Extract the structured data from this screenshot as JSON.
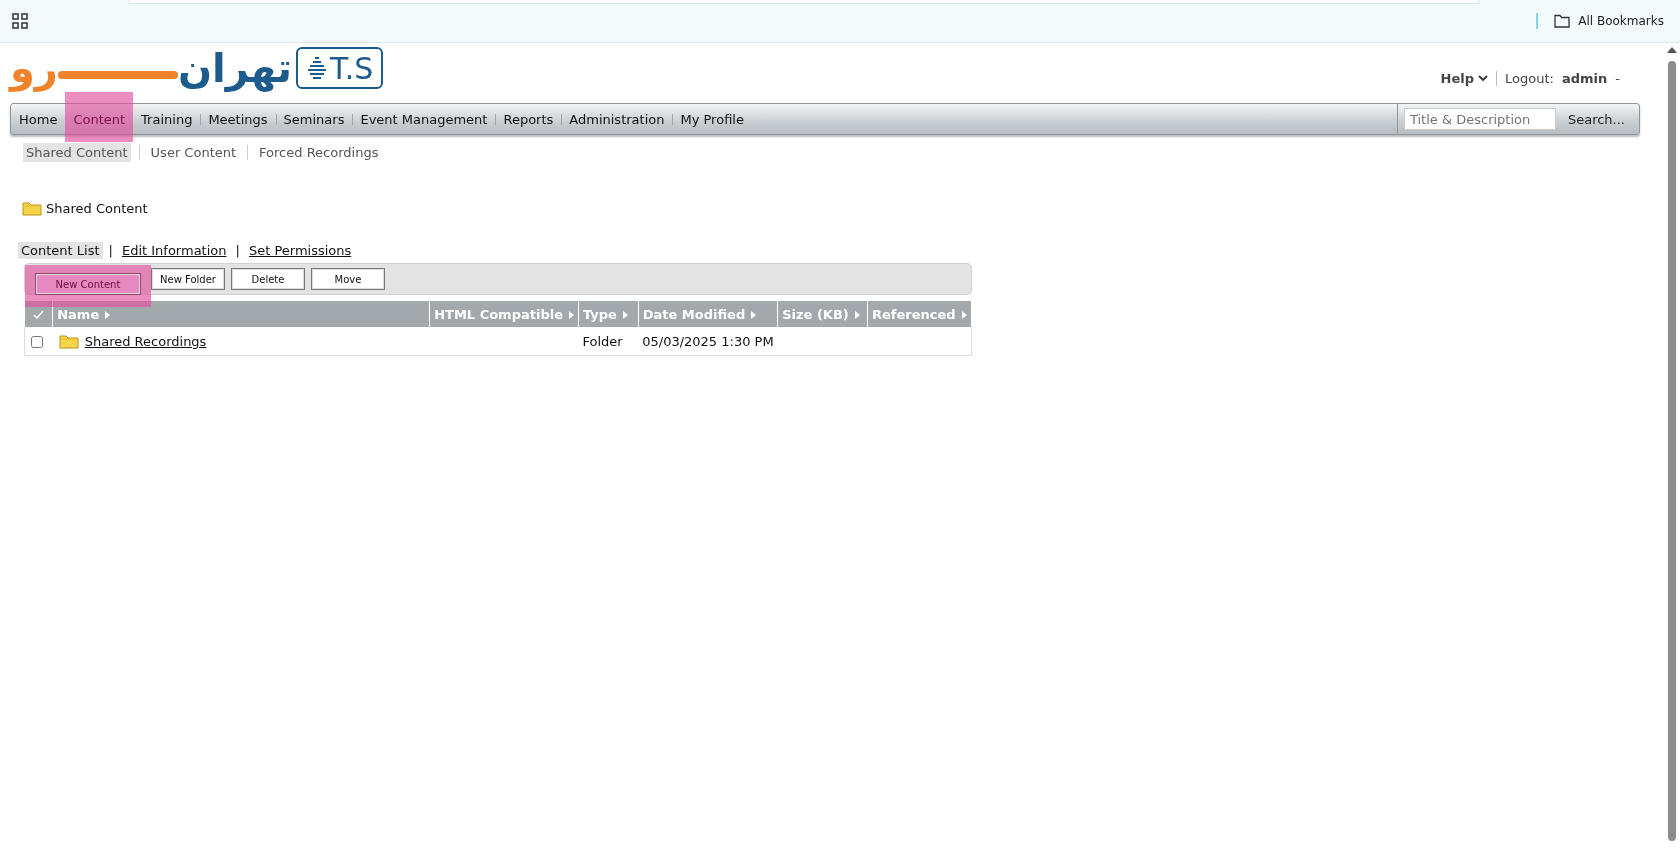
{
  "browser": {
    "bookmarks_label": "All Bookmarks"
  },
  "logo": {
    "mark": "T.S",
    "name_primary": "تهران",
    "name_secondary": "رو"
  },
  "header": {
    "help": "Help",
    "logout_label": "Logout:",
    "user": "admin",
    "user_suffix": "-"
  },
  "nav": {
    "tabs": [
      {
        "label": "Home",
        "selected": false,
        "highlighted": false
      },
      {
        "label": "Content",
        "selected": true,
        "highlighted": true
      },
      {
        "label": "Training",
        "selected": false,
        "highlighted": false
      },
      {
        "label": "Meetings",
        "selected": false,
        "highlighted": false
      },
      {
        "label": "Seminars",
        "selected": false,
        "highlighted": false
      },
      {
        "label": "Event Management",
        "selected": false,
        "highlighted": false
      },
      {
        "label": "Reports",
        "selected": false,
        "highlighted": false
      },
      {
        "label": "Administration",
        "selected": false,
        "highlighted": false
      },
      {
        "label": "My Profile",
        "selected": false,
        "highlighted": false
      }
    ],
    "search": {
      "placeholder": "Title & Description",
      "button": "Search..."
    }
  },
  "subnav": [
    {
      "label": "Shared Content",
      "selected": true
    },
    {
      "label": "User Content",
      "selected": false
    },
    {
      "label": "Forced Recordings",
      "selected": false
    }
  ],
  "breadcrumb": "Shared Content",
  "view_tabs": [
    {
      "label": "Content List",
      "selected": true
    },
    {
      "label": "Edit Information",
      "selected": false
    },
    {
      "label": "Set Permissions",
      "selected": false
    }
  ],
  "view_tab_separators": [
    "|",
    "|"
  ],
  "toolbar": [
    {
      "label": "New Content",
      "highlighted": true
    },
    {
      "label": "New Folder",
      "highlighted": false
    },
    {
      "label": "Delete",
      "highlighted": false
    },
    {
      "label": "Move",
      "highlighted": false
    }
  ],
  "table": {
    "columns": [
      "Name",
      "HTML Compatible",
      "Type",
      "Date Modified",
      "Size (KB)",
      "Referenced"
    ],
    "rows": [
      {
        "checked": false,
        "kind": "folder",
        "name": "Shared Recordings",
        "type": "Folder",
        "date_modified": "05/03/2025 1:30 PM"
      }
    ]
  }
}
